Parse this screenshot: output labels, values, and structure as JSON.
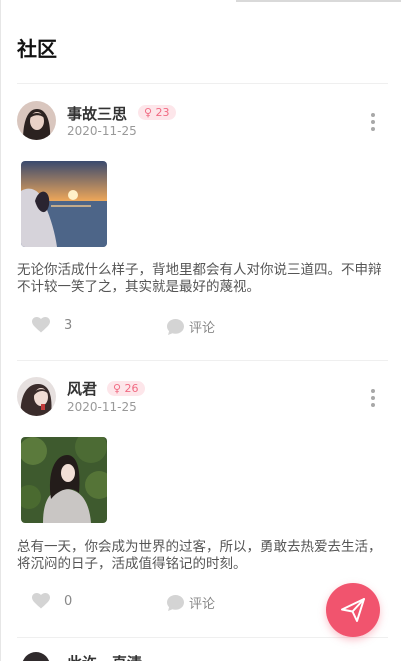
{
  "page": {
    "title": "社区"
  },
  "posts": [
    {
      "username": "事故三思",
      "badge": "♀ 23",
      "date": "2020-11-25",
      "content": "无论你活成什么样子，背地里都会有人对你说三道四。不申辩不计较一笑了之，其实就是最好的蔑视。",
      "likes": "3",
      "comment_label": "评论",
      "avatar_icon": "user-avatar",
      "photo_icon": "sunset-sea-photo"
    },
    {
      "username": "风君",
      "badge": "♀ 26",
      "date": "2020-11-25",
      "content": "总有一天，你会成为世界的过客，所以，勇敢去热爱去生活，将沉闷的日子，活成值得铭记的时刻。",
      "likes": "0",
      "comment_label": "评论",
      "avatar_icon": "user-avatar",
      "photo_icon": "forest-portrait-photo"
    },
    {
      "username": "此许一直清"
    }
  ],
  "fab": {
    "icon": "paper-plane-icon"
  },
  "colors": {
    "accent": "#f1546e",
    "badge_bg": "#fde6ea",
    "badge_text": "#f06a82"
  }
}
